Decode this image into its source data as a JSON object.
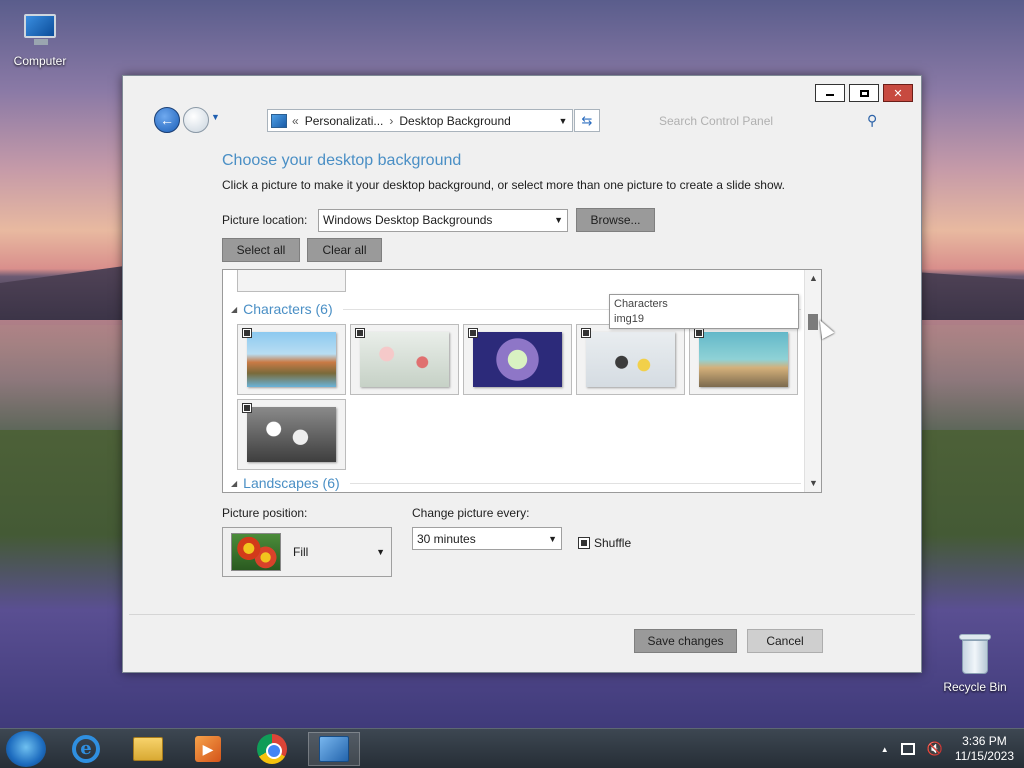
{
  "desktop": {
    "icons": [
      {
        "label": "Computer"
      },
      {
        "label": "Recycle Bin"
      }
    ]
  },
  "window": {
    "controls": {
      "minimize": "minimize-icon",
      "maximize": "maximize-icon",
      "close": "✕"
    },
    "address": {
      "crumbs": [
        "Personalizati...",
        "Desktop Background"
      ],
      "prefix": "«",
      "separator": "›"
    },
    "search": {
      "placeholder": "Search Control Panel"
    },
    "heading": "Choose your desktop background",
    "description": "Click a picture to make it your desktop background, or select more than one picture to create a slide show.",
    "picture_location": {
      "label": "Picture location:",
      "value": "Windows Desktop Backgrounds",
      "browse": "Browse..."
    },
    "select_all": "Select all",
    "clear_all": "Clear all",
    "groups": [
      {
        "name": "Characters (6)",
        "items": [
          "img1",
          "img2",
          "img3",
          "img4",
          "img5",
          "img6"
        ]
      },
      {
        "name": "Landscapes (6)"
      }
    ],
    "tooltip": {
      "title": "Characters",
      "file": "img19"
    },
    "picture_position": {
      "label": "Picture position:",
      "value": "Fill"
    },
    "change_picture": {
      "label": "Change picture every:",
      "value": "30 minutes"
    },
    "shuffle": {
      "label": "Shuffle",
      "checked": true
    },
    "save": "Save changes",
    "cancel": "Cancel"
  },
  "taskbar": {
    "apps": [
      "internet-explorer-icon",
      "file-explorer-icon",
      "media-player-icon",
      "chrome-icon",
      "control-panel-icon"
    ],
    "clock": {
      "time": "3:36 PM",
      "date": "11/15/2023"
    }
  }
}
